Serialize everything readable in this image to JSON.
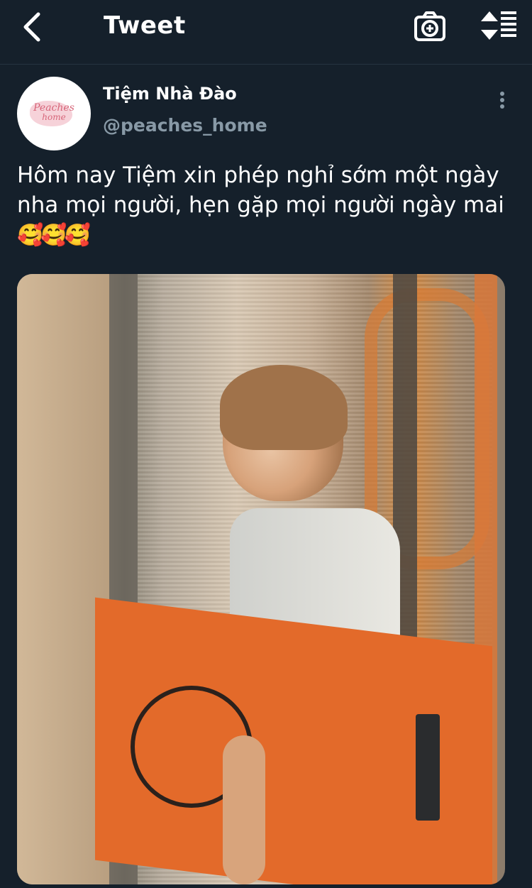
{
  "header": {
    "title": "Tweet",
    "back_icon": "chevron-left-icon",
    "camera_icon": "camera-plus-icon",
    "sort_icon": "sort-list-icon"
  },
  "tweet": {
    "author_name": "Tiệm Nhà Đào",
    "author_handle": "@peaches_home",
    "avatar_logo_line1": "Peaches",
    "avatar_logo_line2": "home",
    "text": "Hôm nay Tiệm xin phép nghỉ sớm một ngày nha mọi người, hẹn gặp mọi người ngày mai",
    "emojis": "🥰🥰🥰",
    "more_icon": "more-vertical-icon",
    "media_description": "photo"
  },
  "colors": {
    "background": "#15202b",
    "text_primary": "#ffffff",
    "text_secondary": "#8899a6"
  }
}
